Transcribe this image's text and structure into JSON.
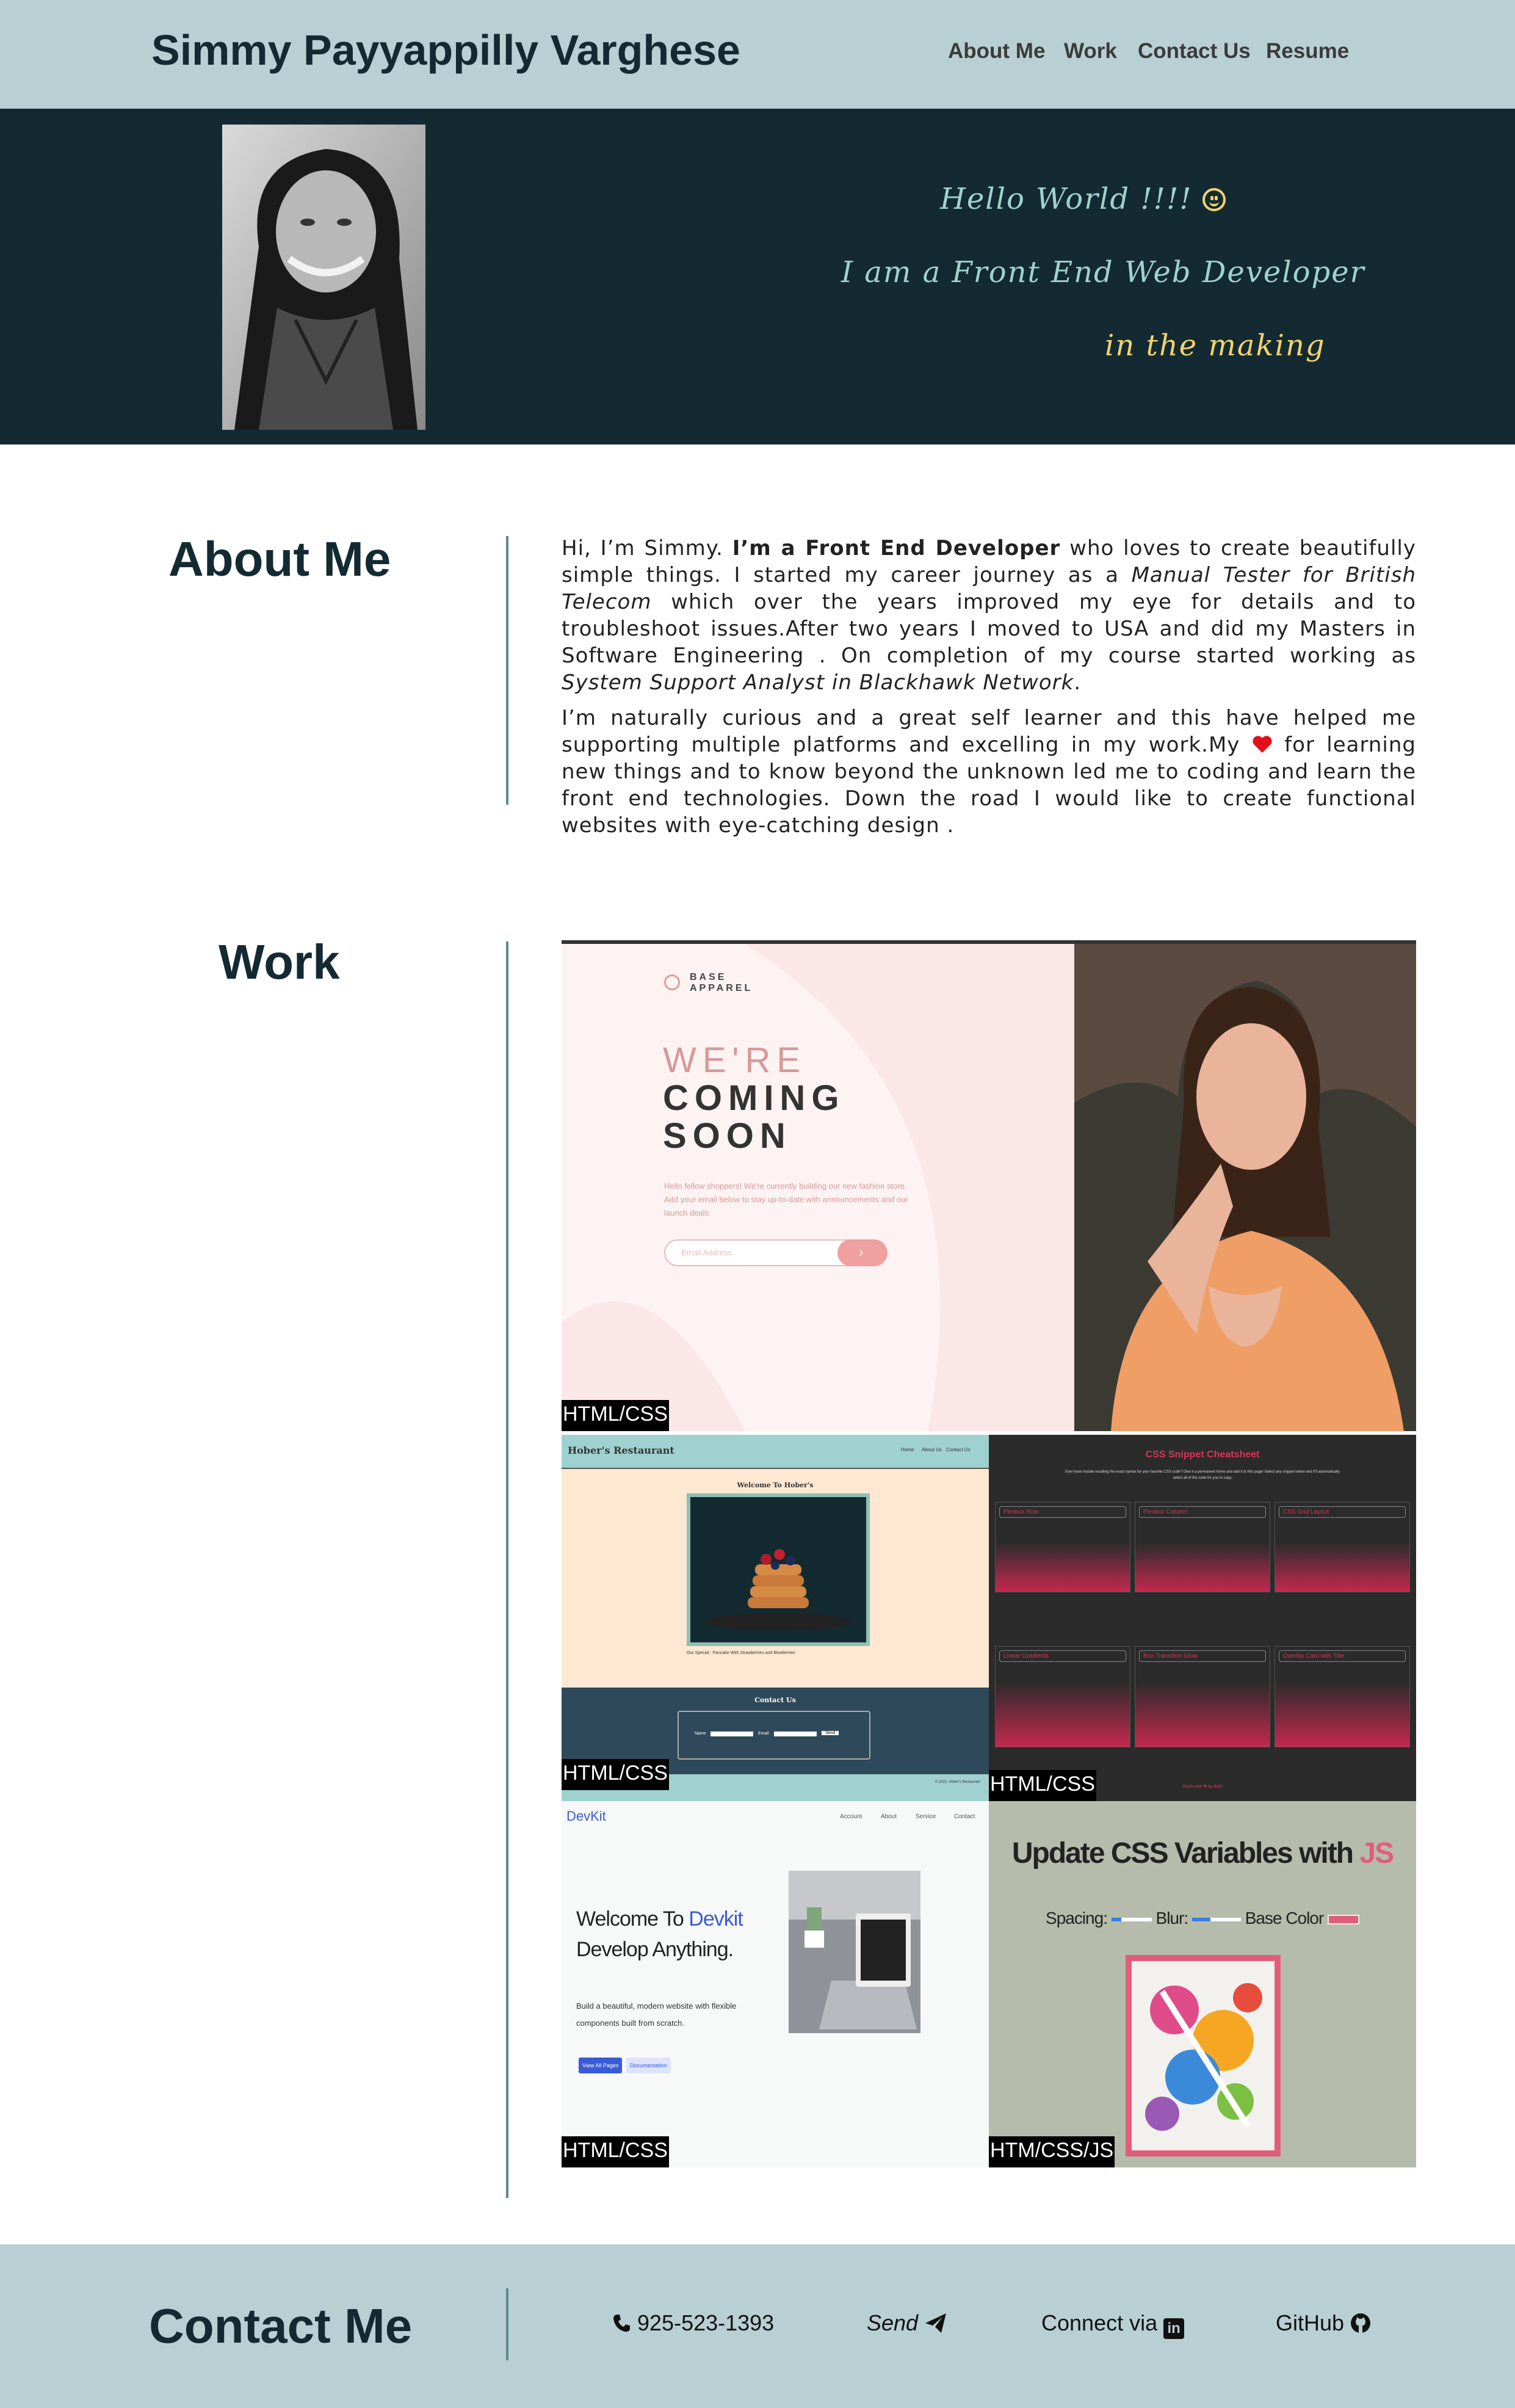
{
  "header": {
    "site_name": "Simmy Payyappilly Varghese",
    "nav": [
      "About Me",
      "Work",
      "Contact Us",
      "Resume"
    ]
  },
  "hero": {
    "line1": "Hello World !!!!",
    "line2": "I am a Front End Web Developer",
    "line3": "in the making"
  },
  "about": {
    "title": "About Me",
    "p1_a": "Hi, I’m Simmy. ",
    "p1_b": "I’m a Front End Developer",
    "p1_c": " who loves to create beautifully simple things. I started my career journey as a ",
    "p1_d": "Manual Tester for British Telecom",
    "p1_e": " which over the years improved my eye for details and to troubleshoot issues.After two years I moved to USA and did my Masters in Software Engineering . On completion of my course started working as ",
    "p1_f": "System Support Analyst in Blackhawk Network",
    "p1_g": ".",
    "p2_a": "I’m naturally curious and a great self learner and this have helped me supporting multiple platforms and excelling in my work.My ",
    "p2_b": " for learning new things and to know beyond the unknown led me to coding and learn the front end technologies. Down the road I would like to create functional websites with eye-catching design ."
  },
  "work": {
    "title": "Work",
    "projects": [
      {
        "tag": "HTML/CSS",
        "brand_line1": "BASE",
        "brand_line2": "APPAREL",
        "heading1": "WE'RE",
        "heading2": "COMING",
        "heading3": "SOON",
        "body": "Hello fellow shoppers! We're currently building our new fashion store. Add your email below to stay up-to-date with announcements and our launch deals.",
        "email_placeholder": "Email Address"
      },
      {
        "tag": "HTML/CSS",
        "site": "Hober's Restaurant",
        "nav": [
          "Home",
          "About Us",
          "Contact Us"
        ],
        "welcome": "Welcome To Hober's",
        "caption": "Our Special : Pancake With Strawberries and Blueberries",
        "contact": "Contact Us",
        "name_label": "Name",
        "email_label": "Email",
        "send": "Send",
        "footer": "© 2022, Hober's Restaurant"
      },
      {
        "tag": "HTML/CSS",
        "title": "CSS Snippet Cheatsheet",
        "subtitle": "Ever have trouble recalling the exact syntax for your favorite CSS code? Give it a permanent home and add it to this page! Select any snippet below and it'll automatically select all of the code for you to copy.",
        "cards": [
          "Flexbox Row",
          "Flexbox Column",
          "CSS Grid Layout",
          "Linear Gradients",
          "Box Transition Glow",
          "Overlay Card with Title"
        ],
        "footer": "Made with ❤ by Bold"
      },
      {
        "tag": "HTML/CSS",
        "brand": "DevKit",
        "nav": [
          "Account",
          "About",
          "Service",
          "Contact"
        ],
        "welcome": "Welcome To",
        "welcome_brand": "Devkit",
        "tagline": "Develop Anything.",
        "desc": "Build a beautiful, modern website with flexible components built from scratch.",
        "btn1": "View All Pages",
        "btn2": "Documentation"
      },
      {
        "tag": "HTM/CSS/JS",
        "title": "Update CSS Variables with",
        "title_js": "JS",
        "spacing": "Spacing:",
        "blur": "Blur:",
        "base_color": "Base Color"
      }
    ]
  },
  "contact": {
    "title": "Contact Me",
    "phone": "925-523-1393",
    "send": "Send",
    "connect": "Connect via",
    "github": "GitHub"
  },
  "colors": {
    "header_bg": "#b8cfd4",
    "dark": "#142a32",
    "teal_text": "#9fd3cc",
    "yellow_text": "#f2d46b",
    "heart": "#e3101a"
  }
}
